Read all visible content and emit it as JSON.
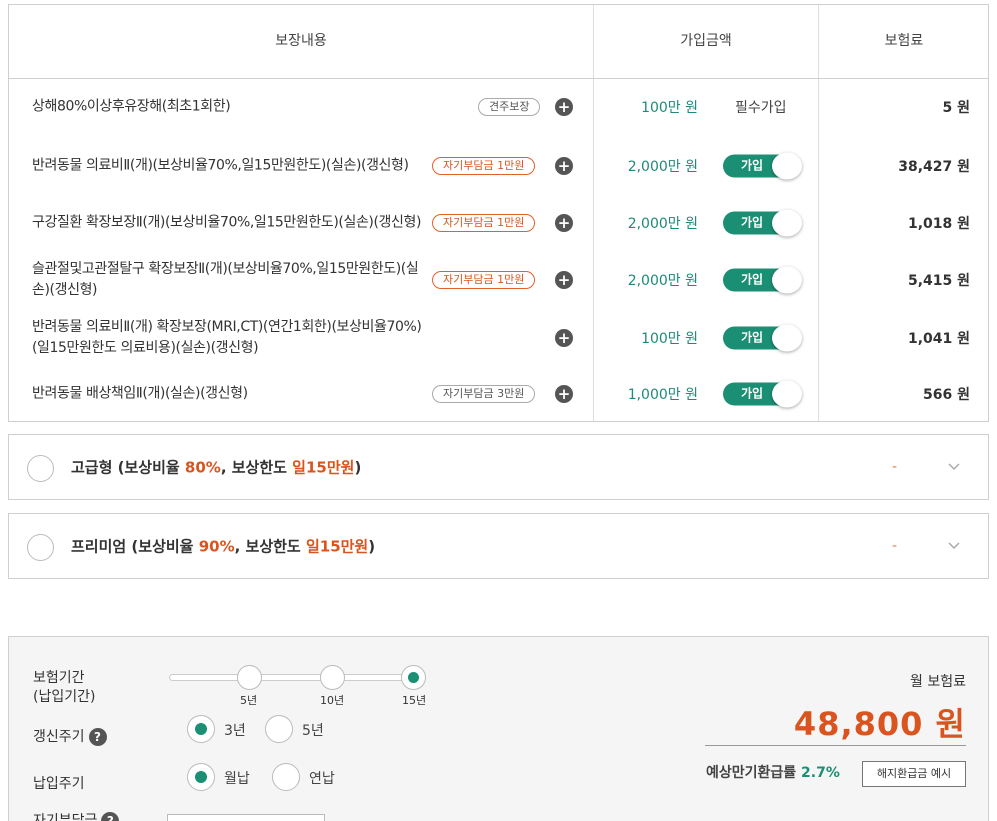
{
  "table": {
    "headers": {
      "coverage": "보장내용",
      "amount": "가입금액",
      "premium": "보험료"
    },
    "rows": [
      {
        "name": "상해80%이상후유장해(최초1회한)",
        "tag": "견주보장",
        "tag_color": "gray",
        "amount": "100만 원",
        "status": "필수가입",
        "premium": "5 원"
      },
      {
        "name": "반려동물 의료비Ⅱ(개)(보상비율70%,일15만원한도)(실손)(갱신형)",
        "tag": "자기부담금 1만원",
        "tag_color": "orange",
        "amount": "2,000만 원",
        "status": "가입",
        "premium": "38,427 원"
      },
      {
        "name": "구강질환 확장보장Ⅱ(개)(보상비율70%,일15만원한도)(실손)(갱신형)",
        "tag": "자기부담금 1만원",
        "tag_color": "orange",
        "amount": "2,000만 원",
        "status": "가입",
        "premium": "1,018 원"
      },
      {
        "name": "슬관절및고관절탈구 확장보장Ⅱ(개)(보상비율70%,일15만원한도)(실손)(갱신형)",
        "tag": "자기부담금 1만원",
        "tag_color": "orange",
        "amount": "2,000만 원",
        "status": "가입",
        "premium": "5,415 원"
      },
      {
        "name": "반려동물 의료비Ⅱ(개) 확장보장(MRI,CT)(연간1회한)(보상비율70%)(일15만원한도 의료비용)(실손)(갱신형)",
        "tag": "",
        "tag_color": "",
        "amount": "100만 원",
        "status": "가입",
        "premium": "1,041 원"
      },
      {
        "name": "반려동물 배상책임Ⅱ(개)(실손)(갱신형)",
        "tag": "자기부담금 3만원",
        "tag_color": "gray",
        "amount": "1,000만 원",
        "status": "가입",
        "premium": "566 원"
      }
    ]
  },
  "plans": [
    {
      "pre": "고급형 (보상비율 ",
      "rate": "80%",
      "mid": ", 보상한도 ",
      "limit": "일15만원",
      "post": ")",
      "price": "-"
    },
    {
      "pre": "프리미엄 (보상비율 ",
      "rate": "90%",
      "mid": ", 보상한도 ",
      "limit": "일15만원",
      "post": ")",
      "price": "-"
    }
  ],
  "options": {
    "period_label_1": "보험기간",
    "period_label_2": "(납입기간)",
    "period_values": [
      "5년",
      "10년",
      "15년"
    ],
    "period_selected": "15년",
    "renewal_label": "갱신주기",
    "renewal_values": [
      "3년",
      "5년"
    ],
    "renewal_selected": "3년",
    "payment_label": "납입주기",
    "payment_values": [
      "월납",
      "연납"
    ],
    "payment_selected": "월납",
    "deductible_label": "자기부담금"
  },
  "summary": {
    "monthly_label": "월 보험료",
    "monthly_premium": "48,800 원",
    "refund_label": "예상만기환급률",
    "refund_rate": "2.7%",
    "refund_button": "해지환급금 예시"
  },
  "colors": {
    "accent": "#1a8f73",
    "highlight": "#d9541e"
  }
}
